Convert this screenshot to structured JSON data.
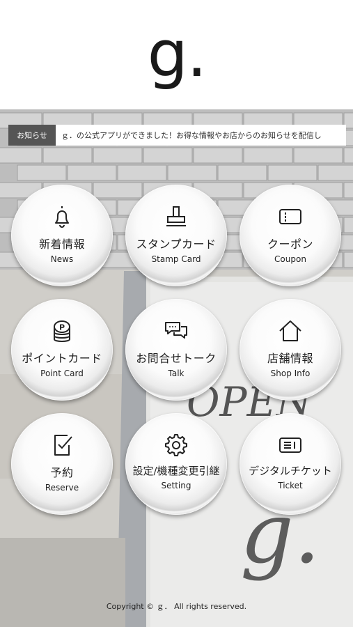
{
  "header": {
    "logo_text": "g."
  },
  "notice": {
    "label": "お知らせ",
    "text": "ｇ．の公式アプリができました！お得な情報やお店からのお知らせを配信し"
  },
  "menu": [
    {
      "label_ja": "新着情報",
      "label_en": "News",
      "icon": "bell-icon"
    },
    {
      "label_ja": "スタンプカード",
      "label_en": "Stamp Card",
      "icon": "stamp-icon"
    },
    {
      "label_ja": "クーポン",
      "label_en": "Coupon",
      "icon": "coupon-icon"
    },
    {
      "label_ja": "ポイントカード",
      "label_en": "Point Card",
      "icon": "coins-icon"
    },
    {
      "label_ja": "お問合せトーク",
      "label_en": "Talk",
      "icon": "chat-icon"
    },
    {
      "label_ja": "店舗情報",
      "label_en": "Shop Info",
      "icon": "house-icon"
    },
    {
      "label_ja": "予約",
      "label_en": "Reserve",
      "icon": "checklist-icon"
    },
    {
      "label_ja": "設定/機種変更引継",
      "label_en": "Setting",
      "icon": "gear-icon"
    },
    {
      "label_ja": "デジタルチケット",
      "label_en": "Ticket",
      "icon": "ticket-icon"
    }
  ],
  "background": {
    "sign_text": "OPEN",
    "sign_letter": "g."
  },
  "footer": {
    "copyright": "Copyright © ｇ．  All rights reserved."
  }
}
